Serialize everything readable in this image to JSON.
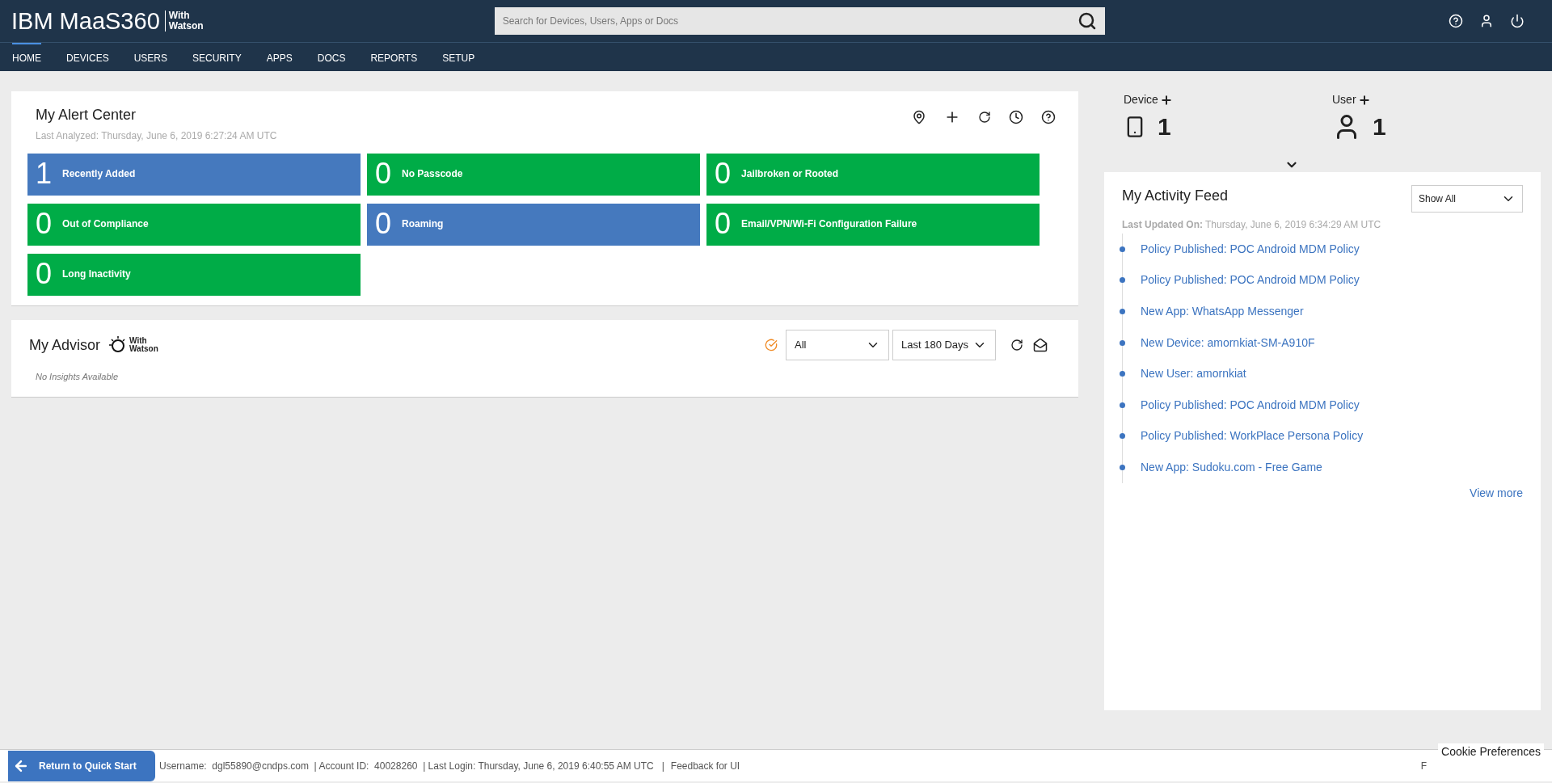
{
  "header": {
    "logo": "IBM MaaS360",
    "logo_suffix_1": "With",
    "logo_suffix_2": "Watson",
    "search": {
      "placeholder": "Search for Devices, Users, Apps or Docs"
    }
  },
  "nav": [
    {
      "label": "HOME",
      "selected": true
    },
    {
      "label": "DEVICES",
      "selected": false
    },
    {
      "label": "USERS",
      "selected": false
    },
    {
      "label": "SECURITY",
      "selected": false
    },
    {
      "label": "APPS",
      "selected": false
    },
    {
      "label": "DOCS",
      "selected": false
    },
    {
      "label": "REPORTS",
      "selected": false
    },
    {
      "label": "SETUP",
      "selected": false
    }
  ],
  "alert_center": {
    "title": "My Alert Center",
    "last_analyzed": "Last Analyzed: Thursday, June 6, 2019 6:27:24 AM UTC",
    "tiles": [
      {
        "count": "1",
        "label": "Recently Added",
        "color": "#4579be"
      },
      {
        "count": "0",
        "label": "No Passcode",
        "color": "#00ac47"
      },
      {
        "count": "0",
        "label": "Jailbroken or Rooted",
        "color": "#00ac47"
      },
      {
        "count": "0",
        "label": "Out of Compliance",
        "color": "#00ac47"
      },
      {
        "count": "0",
        "label": "Roaming",
        "color": "#4579be"
      },
      {
        "count": "0",
        "label": "Email/VPN/Wi-Fi Configuration Failure",
        "color": "#00ac47"
      },
      {
        "count": "0",
        "label": "Long Inactivity",
        "color": "#00ac47"
      }
    ]
  },
  "advisor": {
    "title": "My Advisor",
    "badge_1": "With",
    "badge_2": "Watson",
    "filter": "All",
    "period": "Last 180 Days",
    "empty": "No Insights Available"
  },
  "summary": [
    {
      "label": "Device",
      "count": "1",
      "kind": "device"
    },
    {
      "label": "User",
      "count": "1",
      "kind": "user"
    }
  ],
  "activity_feed": {
    "title": "My Activity Feed",
    "filter": "Show All",
    "updated_label": "Last Updated On:",
    "updated_value": "Thursday, June 6, 2019 6:34:29 AM UTC",
    "items": [
      "Policy Published: POC Android MDM Policy",
      "Policy Published: POC Android MDM Policy",
      "New App: WhatsApp Messenger",
      "New Device: amornkiat-SM-A910F",
      "New User: amornkiat",
      "Policy Published: POC Android MDM Policy",
      "Policy Published: WorkPlace Persona Policy",
      "New App: Sudoku.com - Free Game"
    ],
    "view_more": "View more"
  },
  "footer": {
    "quick_start": "Return to Quick Start",
    "info": "Username:  dgl55890@cndps.com  | Account ID:  40028260  | Last Login: Thursday, June 6, 2019 6:40:55 AM UTC   |",
    "feedback": "Feedback for UI",
    "cut_text": "F",
    "cookie": "Cookie Preferences"
  }
}
